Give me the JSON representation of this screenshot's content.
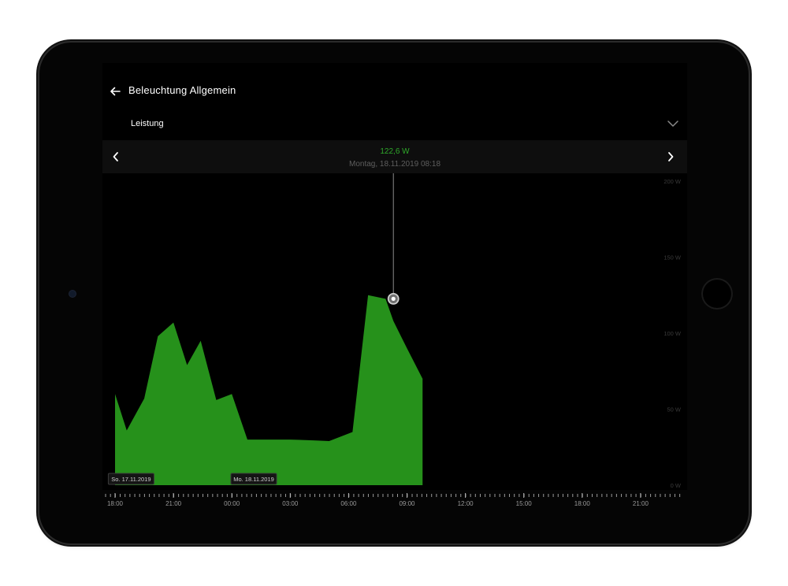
{
  "header": {
    "back_icon": "arrow-left-icon",
    "title": "Beleuchtung Allgemein"
  },
  "metric": {
    "label": "Leistung",
    "icon": "chevron-down-icon"
  },
  "selection": {
    "value": "122,6 W",
    "date": "Montag, 18.11.2019 08:18",
    "prev_icon": "chevron-left-icon",
    "next_icon": "chevron-right-icon"
  },
  "colors": {
    "fill": "#26911b",
    "value_text": "#2fa82a",
    "marker": "#cfcfcf"
  },
  "chart_data": {
    "type": "area",
    "x_unit": "hours since 17.11.2019 18:00",
    "x": [
      0,
      0.6,
      1.5,
      2.2,
      3.0,
      3.7,
      4.4,
      5.2,
      6.0,
      6.8,
      8.1,
      9.0,
      10.2,
      11.0,
      12.2,
      13.0,
      13.9,
      14.3,
      15.0,
      15.8
    ],
    "y": [
      60,
      36,
      57,
      98,
      107,
      79,
      95,
      56,
      60,
      30,
      30,
      30,
      29.5,
      29,
      35,
      125,
      122.6,
      108,
      90,
      70
    ],
    "ylim": [
      0,
      200
    ],
    "yticks": [
      "0 W",
      "50 W",
      "100 W",
      "150 W",
      "200 W"
    ],
    "ytick_values": [
      0,
      50,
      100,
      150,
      200
    ],
    "xticks": [
      "18:00",
      "21:00",
      "00:00",
      "03:00",
      "06:00",
      "09:00",
      "12:00",
      "15:00",
      "18:00",
      "21:00"
    ],
    "xtick_hours": [
      0,
      3,
      6,
      9,
      12,
      15,
      18,
      21,
      24,
      27
    ],
    "x_range_hours": [
      0,
      29.5
    ],
    "selected": {
      "x": 14.3,
      "y": 122.6
    },
    "day_labels": [
      {
        "text": "So. 17.11.2019",
        "x": 0.3
      },
      {
        "text": "Mo. 18.11.2019",
        "x": 6.6
      }
    ]
  }
}
